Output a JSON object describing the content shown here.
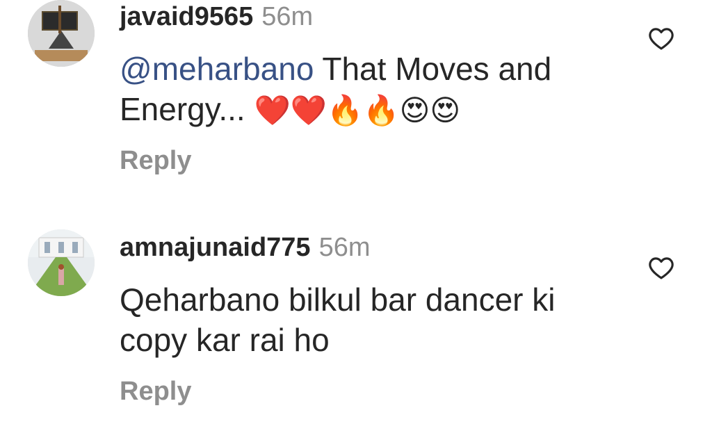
{
  "comments": [
    {
      "username": "javaid9565",
      "time": "56m",
      "mention": "@meharbano",
      "text": " That Moves and Energy... ",
      "emojis": "❤️❤️🔥🔥😍😍",
      "reply_label": "Reply",
      "like_icon": "heart-outline-icon"
    },
    {
      "username": "amnajunaid775",
      "time": "56m",
      "mention": "",
      "text": "Qeharbano bilkul bar dancer ki copy kar rai ho",
      "emojis": "",
      "reply_label": "Reply",
      "like_icon": "heart-outline-icon"
    }
  ],
  "colors": {
    "username": "#262626",
    "muted": "#8e8e8e",
    "mention": "#385185"
  }
}
